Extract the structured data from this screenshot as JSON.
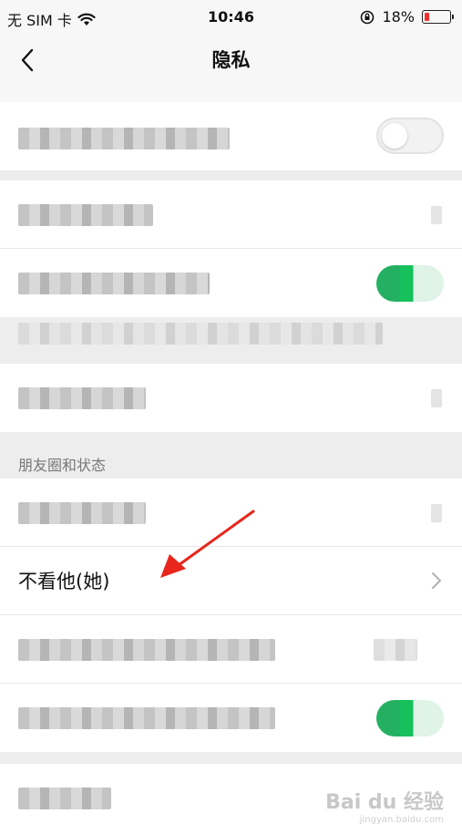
{
  "status_bar": {
    "carrier": "无 SIM 卡",
    "time": "10:46",
    "battery": "18%",
    "battery_level": 0.18,
    "battery_color": "#f0302a"
  },
  "nav": {
    "title": "隐私"
  },
  "section_moments": {
    "header": "朋友圈和状态",
    "visible_item_label": "不看他(她)"
  },
  "watermark": {
    "text": "Bai du 经验",
    "sub": "jingyan.baidu.com"
  },
  "icons": {
    "back": "chevron-left-icon",
    "row_arrow": "chevron-right-icon",
    "wifi": "wifi-icon",
    "rotation_lock": "rotation-lock-icon",
    "battery": "battery-icon"
  },
  "colors": {
    "toggle_on": "#16c15c",
    "arrow_annotation": "#e8261c"
  }
}
